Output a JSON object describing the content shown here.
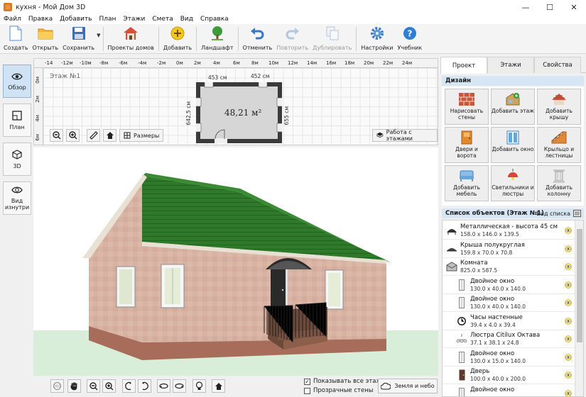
{
  "window": {
    "title": "кухня - Мой Дом 3D",
    "controls": [
      "minimize-icon",
      "maximize-icon",
      "close-icon"
    ]
  },
  "menu": [
    "Файл",
    "Правка",
    "Добавить",
    "План",
    "Этажи",
    "Смета",
    "Вид",
    "Справка"
  ],
  "toolbar": {
    "create": "Создать",
    "open": "Открыть",
    "save": "Сохранить",
    "projects": "Проекты домов",
    "add": "Добавить",
    "landscape": "Ландшафт",
    "undo": "Отменить",
    "redo": "Повторить",
    "duplicate": "Дублировать",
    "settings": "Настройки",
    "tutorial": "Учебник"
  },
  "leftbar": {
    "overview": "Обзор",
    "plan": "План",
    "view3d": "3D",
    "inside": "Вид изнутри"
  },
  "plan": {
    "floor_label": "Этаж №1",
    "area": "48,21 м²",
    "dim_top_left": "453 см",
    "dim_top_right": "452 см",
    "dim_left": "642,5 см",
    "dim_right": "655 см",
    "ruler_top": [
      "-14",
      "-12м",
      "-10м",
      "-8м",
      "-6м",
      "-4м",
      "-2м",
      "0м",
      "2м",
      "4м",
      "6м",
      "8м",
      "10м",
      "12м",
      "14м",
      "16м",
      "18м",
      "20м",
      "22м",
      "24м"
    ],
    "ruler_left": [
      "0м",
      "2м",
      "4м",
      "6м"
    ],
    "sizes_button": "Размеры",
    "floors_button": "Работа с этажами"
  },
  "bottombar": {
    "show_all_floors": "Показывать все этажи",
    "show_all_floors_checked": true,
    "transparent_walls": "Прозрачные стены",
    "transparent_walls_checked": false,
    "ground_sky": "Земля и небо"
  },
  "rightpanel": {
    "tabs": [
      "Проект",
      "Этажи",
      "Свойства"
    ],
    "active_tab": "Проект",
    "design_header": "Дизайн",
    "design_buttons": [
      {
        "label": "Нарисовать стены",
        "icon": "brick-wall-icon"
      },
      {
        "label": "Добавить этаж",
        "icon": "add-floor-icon"
      },
      {
        "label": "Добавить крышу",
        "icon": "roof-icon"
      },
      {
        "label": "Двери и ворота",
        "icon": "door-icon"
      },
      {
        "label": "Добавить окно",
        "icon": "window-icon"
      },
      {
        "label": "Крыльцо и лестницы",
        "icon": "stairs-icon"
      },
      {
        "label": "Добавить мебель",
        "icon": "furniture-icon"
      },
      {
        "label": "Светильники и люстры",
        "icon": "lamp-icon"
      },
      {
        "label": "Добавить колонну",
        "icon": "column-icon"
      }
    ],
    "list_header": "Список объектов (Этаж №1)",
    "list_view": "Вид списка",
    "objects": [
      {
        "name": "Металлическая - высота 45 см",
        "size": "158.0 x 146.0 x 139.5",
        "indent": false,
        "icon": "canopy-icon"
      },
      {
        "name": "Крыша полукруглая",
        "size": "159.8 x 70.0 x 70.8",
        "indent": false,
        "icon": "roof-icon"
      },
      {
        "name": "Комната",
        "size": "825.0 x 587.5",
        "indent": false,
        "icon": "room-icon"
      },
      {
        "name": "Двойное окно",
        "size": "130.0 x 40.0 x 140.0",
        "indent": true,
        "icon": "window-icon"
      },
      {
        "name": "Двойное окно",
        "size": "130.0 x 40.0 x 140.0",
        "indent": true,
        "icon": "window-icon"
      },
      {
        "name": "Часы настенные",
        "size": "39.4 x 4.0 x 39.4",
        "indent": true,
        "icon": "clock-icon"
      },
      {
        "name": "Люстра Citilux Октава",
        "size": "37.1 x 38.1 x 24.8",
        "indent": true,
        "icon": "chandelier-icon"
      },
      {
        "name": "Двойное окно",
        "size": "130.0 x 15.0 x 140.0",
        "indent": true,
        "icon": "window-icon"
      },
      {
        "name": "Дверь",
        "size": "100.0 x 40.0 x 200.0",
        "indent": true,
        "icon": "door-icon"
      },
      {
        "name": "Двойное окно",
        "size": "",
        "indent": true,
        "icon": "window-icon"
      }
    ]
  },
  "colors": {
    "accent": "#cfe3f5",
    "section_header": "#d7e6f4",
    "wall": "#d8b0a0",
    "roof": "#2f7a2a",
    "base": "#a76d5a",
    "ground": "#d9eed9"
  }
}
